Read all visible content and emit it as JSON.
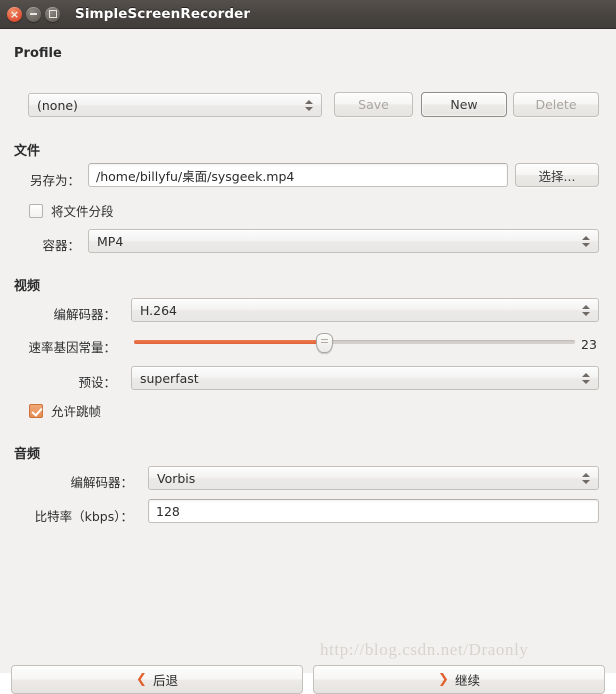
{
  "window": {
    "title": "SimpleScreenRecorder",
    "buttons": {
      "close": "close-button",
      "minimize": "minimize-button",
      "maximize": "maximize-button"
    }
  },
  "profile": {
    "heading": "Profile",
    "selected": "(none)",
    "save_label": "Save",
    "new_label": "New",
    "delete_label": "Delete"
  },
  "file": {
    "heading": "文件",
    "save_as_label": "另存为：",
    "save_as_value": "/home/billyfu/桌面/sysgeek.mp4",
    "browse_label": "选择...",
    "segment_label": "将文件分段",
    "segment_checked": false,
    "container_label": "容器：",
    "container_value": "MP4"
  },
  "video": {
    "heading": "视频",
    "codec_label": "编解码器：",
    "codec_value": "H.264",
    "crf_label": "速率基因常量：",
    "crf_value": "23",
    "crf_min": 0,
    "crf_max": 51,
    "crf_percent": 43,
    "preset_label": "预设：",
    "preset_value": "superfast",
    "allow_skip_label": "允许跳帧",
    "allow_skip_checked": true
  },
  "audio": {
    "heading": "音频",
    "codec_label": "编解码器：",
    "codec_value": "Vorbis",
    "bitrate_label": "比特率（kbps）：",
    "bitrate_value": "128"
  },
  "navigation": {
    "back_label": "后退",
    "back_icon": "❮",
    "continue_label": "继续",
    "continue_icon": "❯"
  },
  "watermark": {
    "text": "http://blog.csdn.net/Draonly"
  },
  "colors": {
    "accent": "#e2603a",
    "window_bg": "#f2f1f0",
    "titlebar": "#474340"
  }
}
